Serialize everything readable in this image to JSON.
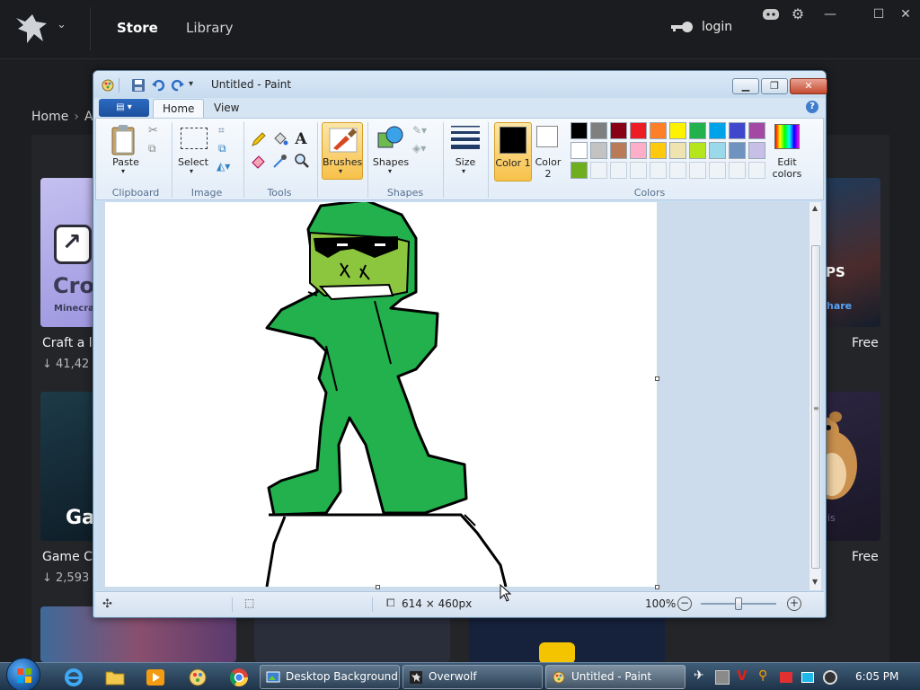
{
  "overwolf": {
    "nav": {
      "store": "Store",
      "library": "Library"
    },
    "login": "login",
    "window_controls": {
      "minimize": "—",
      "maximize": "☐",
      "close": "✕"
    },
    "breadcrumb": [
      "Home",
      "A"
    ],
    "cards": [
      {
        "title": "Craft a lo",
        "downloads": "41,42",
        "logo_text": "Cro",
        "logo_sub": "Minecra",
        "price": "Free"
      },
      {
        "title": "Game Ca",
        "downloads": "2,593",
        "logo_text": "Ga",
        "price": "Free"
      }
    ],
    "side_card_text": "PS",
    "side_card_sub": "hare",
    "side_card_sub2": "is"
  },
  "paint": {
    "title": "Untitled - Paint",
    "tabs": [
      "Home",
      "View"
    ],
    "help": "?",
    "groups": {
      "clipboard": "Clipboard",
      "image": "Image",
      "tools": "Tools",
      "shapes": "Shapes",
      "colors": "Colors"
    },
    "buttons": {
      "paste": "Paste",
      "select": "Select",
      "brushes": "Brushes",
      "shapes": "Shapes",
      "size": "Size",
      "color1": "Color 1",
      "color2": "Color 2",
      "edit_colors": "Edit colors"
    },
    "palette_row1": [
      "#000000",
      "#7f7f7f",
      "#880015",
      "#ed1c24",
      "#ff7f27",
      "#fff200",
      "#22b14c",
      "#00a2e8",
      "#3f48cc",
      "#a349a4"
    ],
    "palette_row2": [
      "#ffffff",
      "#c3c3c3",
      "#b97a57",
      "#ffaec9",
      "#ffc90e",
      "#efe4b0",
      "#b5e61d",
      "#99d9ea",
      "#7092be",
      "#c8bfe7"
    ],
    "palette_row3": [
      "#6fae1c"
    ],
    "color1": "#000000",
    "color2": "#ffffff",
    "status": {
      "canvas_size": "614 × 460px",
      "zoom": "100%",
      "zoom_level": 0.5
    }
  },
  "taskbar": {
    "tasks": [
      {
        "label": "Desktop Background"
      },
      {
        "label": "Overwolf"
      },
      {
        "label": "Untitled - Paint"
      }
    ],
    "clock": "6:05 PM"
  }
}
